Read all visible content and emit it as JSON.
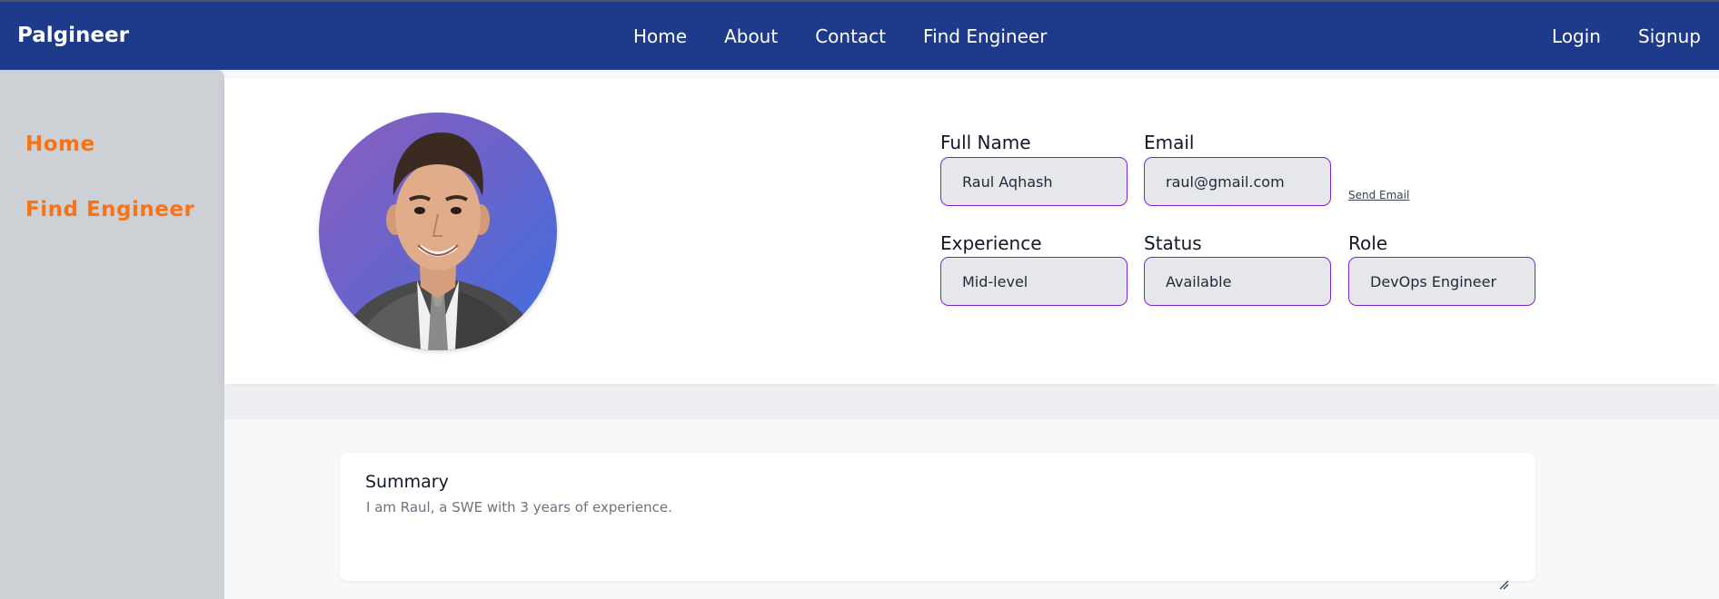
{
  "navbar": {
    "brand": "Palgineer",
    "links": [
      "Home",
      "About",
      "Contact",
      "Find Engineer"
    ],
    "auth": {
      "login": "Login",
      "signup": "Signup"
    }
  },
  "sidebar": {
    "items": [
      {
        "label": "Home"
      },
      {
        "label": "Find Engineer"
      }
    ]
  },
  "profile": {
    "avatar_alt": "profile photo of a smiling man in a suit",
    "fields": {
      "full_name": {
        "label": "Full Name",
        "value": "Raul Aqhash"
      },
      "email": {
        "label": "Email",
        "value": "raul@gmail.com"
      },
      "experience": {
        "label": "Experience",
        "value": "Mid-level"
      },
      "status": {
        "label": "Status",
        "value": "Available"
      },
      "role": {
        "label": "Role",
        "value": "DevOps Engineer"
      }
    },
    "send_email": "Send Email"
  },
  "summary": {
    "title": "Summary",
    "text": "I am Raul, a SWE with 3 years of experience."
  },
  "colors": {
    "navbar_bg": "#1e3a8a",
    "sidebar_bg": "#cdd0d4",
    "sidebar_link": "#f97316",
    "input_border": "#7e22ce",
    "input_bg": "#e5e7eb"
  }
}
